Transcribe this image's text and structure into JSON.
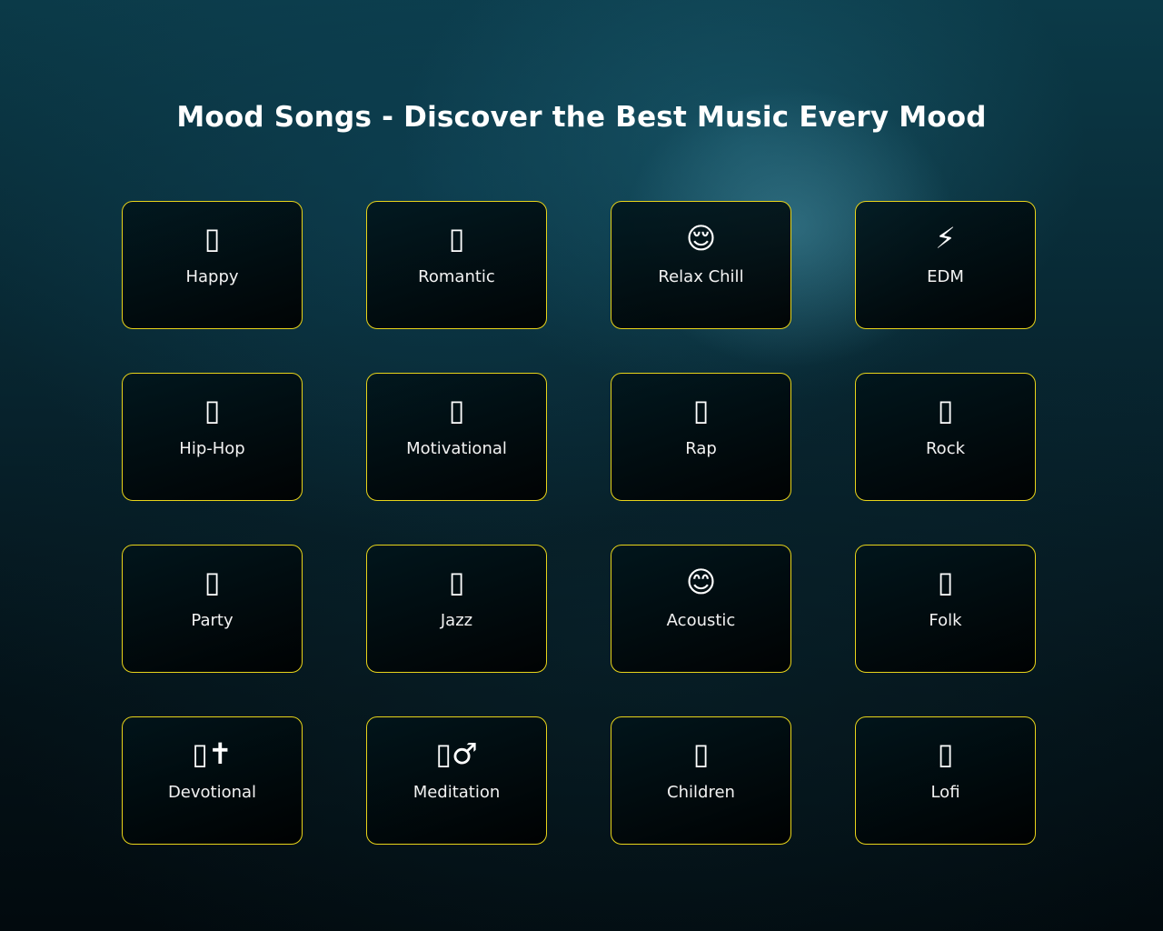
{
  "page": {
    "title": "Mood Songs - Discover the Best Music Every Mood"
  },
  "moods": [
    {
      "label": "Happy",
      "icon": "▯",
      "icon_name": "missing-glyph-icon"
    },
    {
      "label": "Romantic",
      "icon": "▯",
      "icon_name": "missing-glyph-icon"
    },
    {
      "label": "Relax Chill",
      "icon": "😌",
      "icon_name": "relieved-face-icon"
    },
    {
      "label": "EDM",
      "icon": "⚡",
      "icon_name": "lightning-icon"
    },
    {
      "label": "Hip-Hop",
      "icon": "▯",
      "icon_name": "missing-glyph-icon"
    },
    {
      "label": "Motivational",
      "icon": "▯",
      "icon_name": "missing-glyph-icon"
    },
    {
      "label": "Rap",
      "icon": "▯",
      "icon_name": "missing-glyph-icon"
    },
    {
      "label": "Rock",
      "icon": "▯",
      "icon_name": "missing-glyph-icon"
    },
    {
      "label": "Party",
      "icon": "▯",
      "icon_name": "missing-glyph-icon"
    },
    {
      "label": "Jazz",
      "icon": "▯",
      "icon_name": "missing-glyph-icon"
    },
    {
      "label": "Acoustic",
      "icon": "😊",
      "icon_name": "smiling-face-icon"
    },
    {
      "label": "Folk",
      "icon": "▯",
      "icon_name": "missing-glyph-icon"
    },
    {
      "label": "Devotional",
      "icon": "▯✝",
      "icon_name": "cross-icon"
    },
    {
      "label": "Meditation",
      "icon": "▯♂",
      "icon_name": "male-sign-icon"
    },
    {
      "label": "Children",
      "icon": "▯",
      "icon_name": "missing-glyph-icon"
    },
    {
      "label": "Lofi",
      "icon": "▯",
      "icon_name": "missing-glyph-icon"
    }
  ],
  "colors": {
    "card_border": "#e8d41a",
    "text": "#ffffff"
  }
}
